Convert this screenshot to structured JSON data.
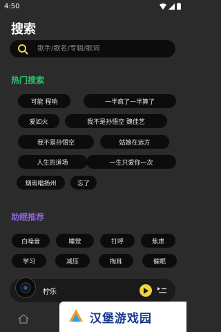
{
  "status_bar": {
    "time": "4:50"
  },
  "header": {
    "title": "搜索"
  },
  "search": {
    "placeholder": "歌手/歌名/专辑/歌词",
    "value": ""
  },
  "hot_section": {
    "title": "热门搜索",
    "tags": [
      "可能 程响",
      "一半疯了一半算了",
      "爱如火",
      "我不是孙悟空 魏佳艺",
      "我不是孙悟空",
      "姑娘在远方",
      "人生的道场",
      "一生只爱你一次",
      "烟雨唱扬州",
      "忘了"
    ]
  },
  "sleep_section": {
    "title": "助眠推荐",
    "tags": [
      "白噪音",
      "睡觉",
      "打呼",
      "焦虑",
      "学习",
      "减压",
      "掏耳",
      "催眠"
    ]
  },
  "player": {
    "track_title": "柠乐",
    "play_icon": "play-icon",
    "queue_icon": "playlist-icon"
  },
  "tab_bar": {
    "home_icon": "home-icon"
  },
  "watermark": {
    "text": "汉堡游戏园"
  },
  "colors": {
    "background": "#2b2b2b",
    "hot_accent": "#2ebd6b",
    "sleep_accent": "#8a63d2",
    "search_icon": "#f2d33c",
    "play_button": "#f2d33c"
  }
}
